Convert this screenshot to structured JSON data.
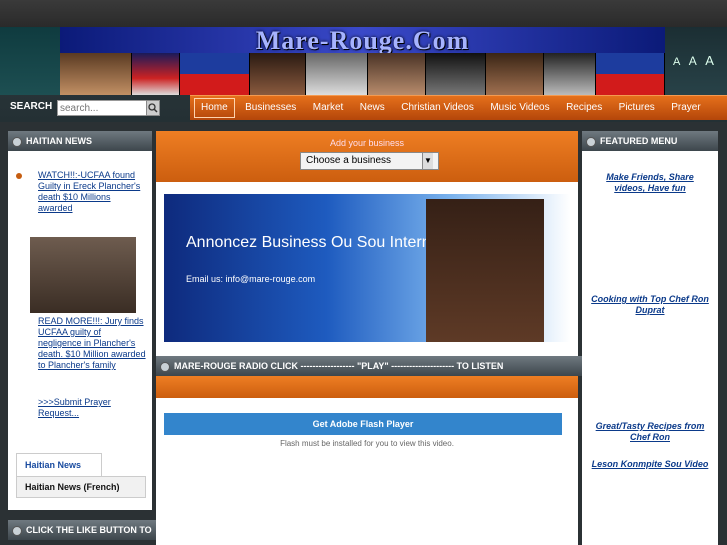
{
  "header": {
    "site_logo": "Mare-Rouge.Com",
    "font_size_controls": [
      "A",
      "A",
      "A"
    ]
  },
  "search": {
    "label": "SEARCH",
    "placeholder": "search..."
  },
  "nav": {
    "items": [
      "Home",
      "Businesses",
      "Market",
      "News",
      "Christian Videos",
      "Music Videos",
      "Recipes",
      "Pictures",
      "Prayer"
    ]
  },
  "left_panel": {
    "title": "HAITIAN NEWS",
    "news1": "WATCH!!:-UCFAA found Guilty in Ereck Plancher's death $10 Millions awarded",
    "news2": "READ MORE!!!: Jury finds UCFAA guilty of negligence in Plancher's death. $10 Million awarded to Plancher's family",
    "news3": ">>>Submit Prayer Request...",
    "tab1": "Haitian News",
    "tab2": "Haitian News (French)",
    "like_title": "CLICK THE LIKE BUTTON TO"
  },
  "center": {
    "add_business": "Add your business",
    "select_value": "Choose a business",
    "banner_title": "Annoncez Business Ou Sou Internet",
    "banner_email": "Email us: info@mare-rouge.com",
    "radio_bar": "MARE-ROUGE RADIO CLICK ------------------ \"PLAY\" --------------------- TO LISTEN",
    "flash_button": "Get Adobe Flash Player",
    "flash_note": "Flash must be installed for you to view this video."
  },
  "right_panel": {
    "title": "FEATURED MENU",
    "link1": "Make Friends, Share videos, Have fun",
    "link2": "Cooking with Top Chef Ron Duprat",
    "link3": "Great/Tasty Recipes from Chef Ron",
    "link4": "Leson Konmpite Sou Video"
  },
  "colors": {
    "nav_orange": "#e5701b",
    "logo_blue": "#0b1a78",
    "link_blue": "#0b3a8a",
    "flash_blue": "#3385cc"
  }
}
